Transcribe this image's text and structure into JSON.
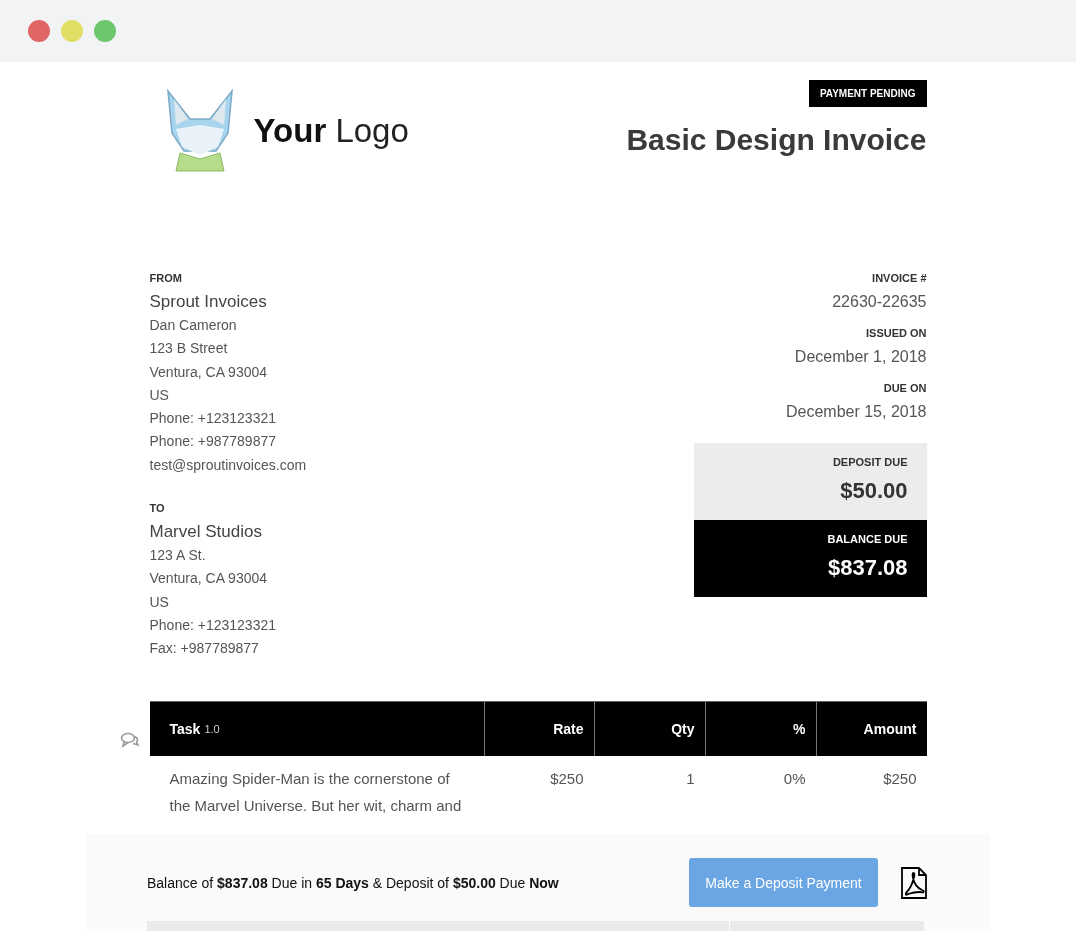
{
  "window": {
    "controls": [
      {
        "color": "#e06666"
      },
      {
        "color": "#e0e066"
      },
      {
        "color": "#6cc66c"
      }
    ]
  },
  "header": {
    "logo_bold": "Your",
    "logo_light": "Logo",
    "status_badge": "PAYMENT PENDING",
    "title": "Basic Design Invoice"
  },
  "from": {
    "label": "FROM",
    "name": "Sprout Invoices",
    "lines": [
      "Dan Cameron",
      "123 B Street",
      "Ventura, CA 93004",
      "US",
      "Phone: +123123321",
      "Phone: +987789877",
      "test@sproutinvoices.com"
    ]
  },
  "to": {
    "label": "TO",
    "name": "Marvel Studios",
    "lines": [
      "123 A St.",
      "Ventura, CA 93004",
      "US",
      "Phone: +123123321",
      "Fax: +987789877"
    ]
  },
  "meta": [
    {
      "label": "INVOICE #",
      "value": "22630-22635"
    },
    {
      "label": "ISSUED ON",
      "value": "December 1, 2018"
    },
    {
      "label": "DUE ON",
      "value": "December 15, 2018"
    }
  ],
  "totals": [
    {
      "kind": "deposit",
      "label": "DEPOSIT DUE",
      "amount": "$50.00"
    },
    {
      "kind": "balance",
      "label": "BALANCE DUE",
      "amount": "$837.08"
    }
  ],
  "table": {
    "columns": [
      {
        "label": "Task",
        "sub": "1.0"
      },
      {
        "label": "Rate"
      },
      {
        "label": "Qty"
      },
      {
        "label": "%"
      },
      {
        "label": "Amount"
      }
    ],
    "rows": [
      {
        "task": "Amazing Spider-Man is the cornerstone of the Marvel Universe. But her wit, charm and",
        "rate": "$250",
        "qty": "1",
        "percent": "0%",
        "amount": "$250"
      }
    ]
  },
  "payment_bar": {
    "summary": "Balance of **$837.08** Due in **65 Days** & Deposit of **$50.00** Due **Now**",
    "button": "Make a **Deposit Payment**"
  }
}
